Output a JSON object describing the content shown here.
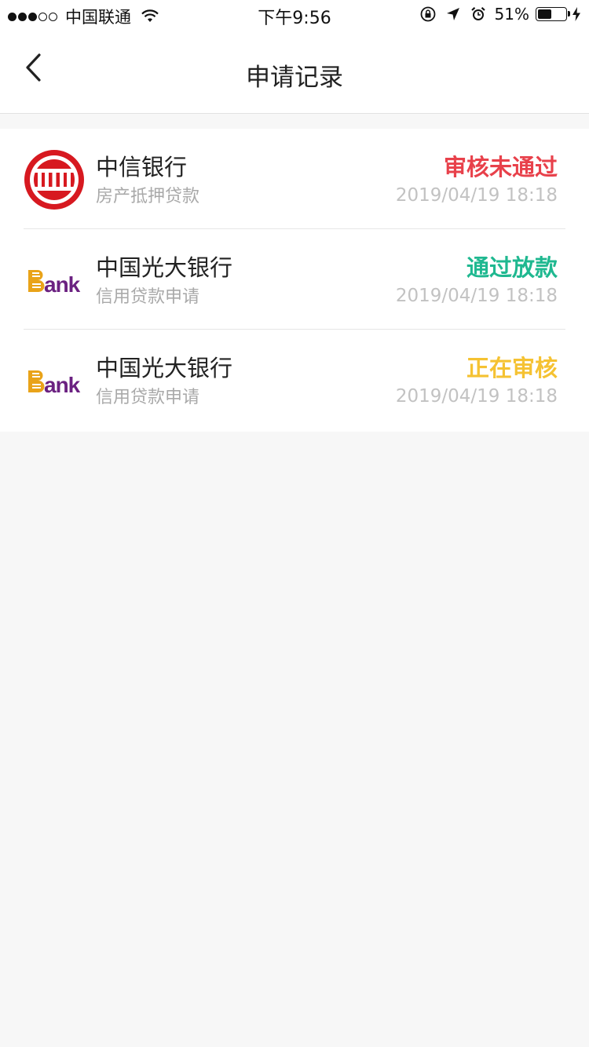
{
  "status_bar": {
    "carrier": "中国联通",
    "time": "下午9:56",
    "battery": "51%",
    "battery_level": 0.51
  },
  "nav": {
    "title": "申请记录",
    "back_icon": "chevron-left-icon"
  },
  "colors": {
    "rejected": "#e8414b",
    "approved": "#1fb890",
    "pending": "#f5c232"
  },
  "records": [
    {
      "bank": "中信银行",
      "product": "房产抵押贷款",
      "status": "审核未通过",
      "status_type": "rejected",
      "time": "2019/04/19 18:18",
      "logo": "citic-logo"
    },
    {
      "bank": "中国光大银行",
      "product": "信用贷款申请",
      "status": "通过放款",
      "status_type": "approved",
      "time": "2019/04/19 18:18",
      "logo": "bank-logo"
    },
    {
      "bank": "中国光大银行",
      "product": "信用贷款申请",
      "status": "正在审核",
      "status_type": "pending",
      "time": "2019/04/19 18:18",
      "logo": "bank-logo"
    }
  ]
}
